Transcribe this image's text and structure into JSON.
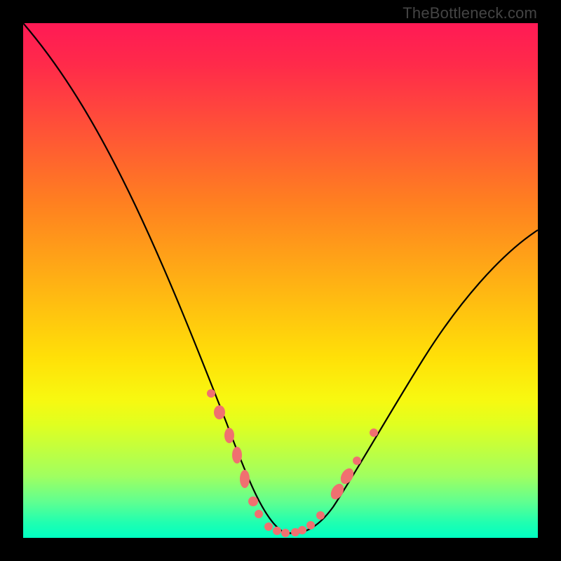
{
  "watermark": "TheBottleneck.com",
  "chart_data": {
    "type": "line",
    "title": "",
    "xlabel": "",
    "ylabel": "",
    "xlim": [
      0,
      100
    ],
    "ylim": [
      0,
      100
    ],
    "series": [
      {
        "name": "bottleneck-curve",
        "x": [
          0,
          5,
          10,
          15,
          20,
          25,
          30,
          35,
          40,
          42,
          45,
          48,
          50,
          52,
          55,
          58,
          60,
          65,
          70,
          75,
          80,
          85,
          90,
          95,
          100
        ],
        "y": [
          100,
          91,
          82,
          72,
          62,
          52,
          42,
          31,
          18,
          12,
          7,
          3,
          1,
          1,
          1,
          2,
          4,
          9,
          16,
          23,
          30,
          38,
          46,
          53,
          60
        ]
      },
      {
        "name": "highlight-markers",
        "x": [
          36,
          38,
          40,
          42,
          44,
          46,
          48,
          50,
          52,
          54,
          56,
          58,
          60,
          62,
          64
        ],
        "y": [
          28,
          22,
          17,
          12,
          8,
          5,
          3,
          1,
          1,
          1,
          1,
          2,
          4,
          7,
          11
        ]
      }
    ],
    "gradient_note": "background vertical gradient red→yellow→green indicating bottleneck severity (top=bad, bottom=good)"
  }
}
